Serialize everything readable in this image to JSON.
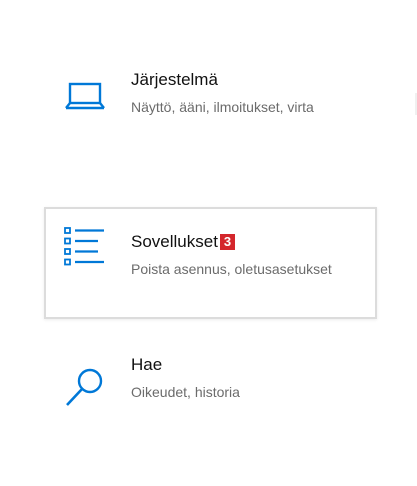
{
  "settings_items": [
    {
      "title": "Järjestelmä",
      "subtitle": "Näyttö, ääni, ilmoitukset, virta",
      "icon": "laptop-icon"
    },
    {
      "title": "Sovellukset",
      "subtitle": "Poista asennus, oletusasetukset",
      "icon": "apps-list-icon",
      "badge": "3",
      "selected": true
    },
    {
      "title": "Hae",
      "subtitle": "Oikeudet, historia",
      "icon": "search-icon"
    }
  ],
  "colors": {
    "accent": "#0078d7",
    "badge": "#d4262c",
    "title_text": "#111111",
    "subtitle_text": "#6b6b6b",
    "selected_border": "#dcdcdc"
  }
}
